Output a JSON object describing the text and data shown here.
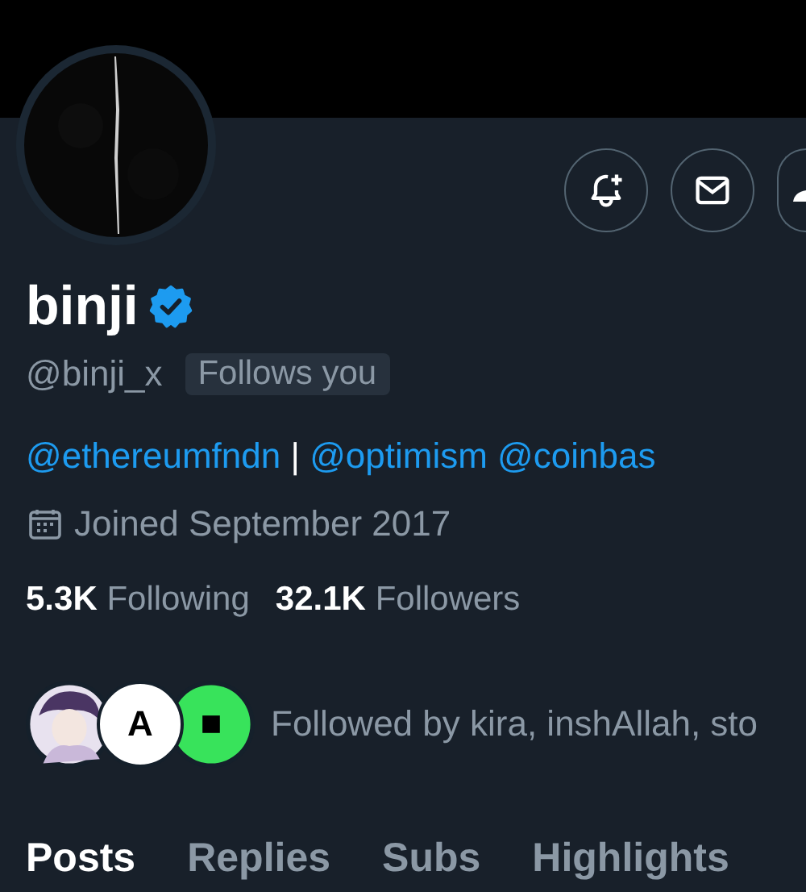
{
  "profile": {
    "name": "binji",
    "verified": true,
    "handle": "@binji_x",
    "follows_you_badge": "Follows you"
  },
  "actions": [
    {
      "kind": "notify"
    },
    {
      "kind": "message"
    },
    {
      "kind": "more"
    }
  ],
  "bio": [
    {
      "kind": "mention",
      "text": "@ethereumfndn"
    },
    {
      "kind": "text",
      "text": "|"
    },
    {
      "kind": "mention",
      "text": "@optimism"
    },
    {
      "kind": "mention",
      "text": "@coinbas"
    }
  ],
  "joined": "Joined September 2017",
  "stats": [
    {
      "count": "5.3K",
      "label": "Following"
    },
    {
      "count": "32.1K",
      "label": "Followers"
    }
  ],
  "followed_by": {
    "avatars": [
      {
        "kind": "picture"
      },
      {
        "kind": "letter",
        "text": "A"
      },
      {
        "kind": "square"
      }
    ],
    "text": "Followed by kira, inshAllah, sto"
  },
  "tabs": [
    {
      "label": "Posts",
      "selected": true
    },
    {
      "label": "Replies",
      "selected": false
    },
    {
      "label": "Subs",
      "selected": false
    },
    {
      "label": "Highlights",
      "selected": false
    }
  ]
}
